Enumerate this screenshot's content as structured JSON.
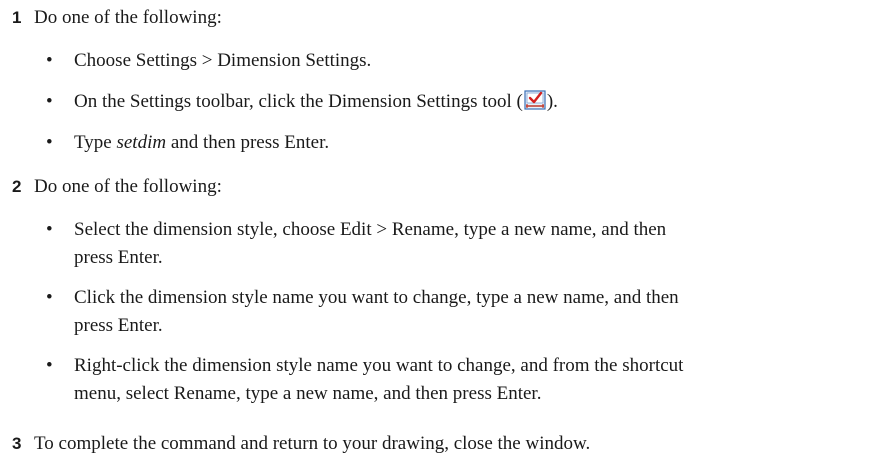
{
  "steps": [
    {
      "number": "1",
      "text": "Do one of the following:",
      "bullets": [
        {
          "text": "Choose Settings > Dimension Settings."
        },
        {
          "before": "On the Settings toolbar, click the Dimension Settings tool (",
          "after": ")."
        },
        {
          "prefix": "Type ",
          "command": "setdim",
          "suffix": " and then press Enter."
        }
      ]
    },
    {
      "number": "2",
      "text": "Do one of the following:",
      "bullets": [
        {
          "line1": "Select the dimension style, choose Edit > Rename, type a new name, and then",
          "line2": "press Enter."
        },
        {
          "line1": "Click the dimension style name you want to change, type a new name, and then",
          "line2": "press Enter."
        },
        {
          "line1": "Right-click the dimension style name you want to change, and from the shortcut",
          "line2": "menu, select Rename, type a new name, and then press Enter."
        }
      ]
    },
    {
      "number": "3",
      "text": "To complete the command and return to your drawing, close the window."
    }
  ],
  "bullet_char": "•",
  "icons": {
    "dimension_settings_tool": "dimension-settings-icon"
  },
  "colors": {
    "icon_frame": "#3a6fb5",
    "icon_check": "#d42020",
    "icon_bar": "#c0392b"
  }
}
